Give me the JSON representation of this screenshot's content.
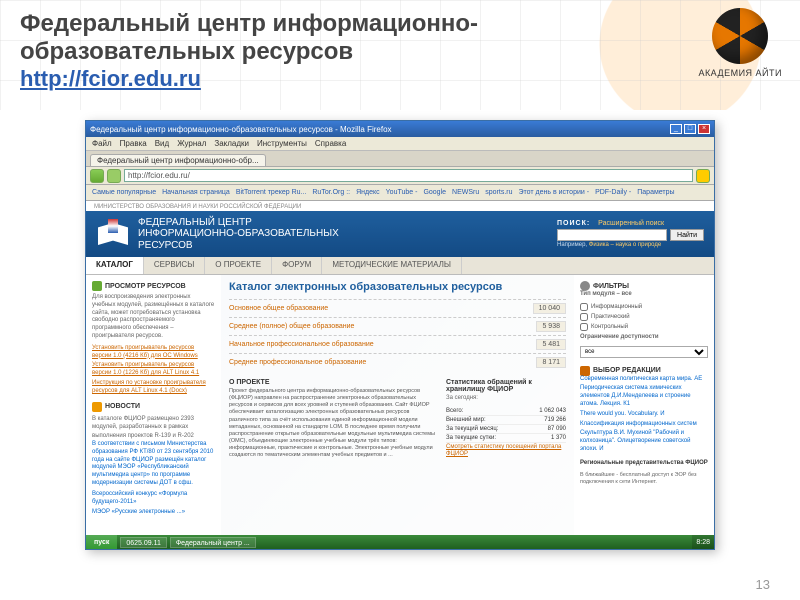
{
  "slide": {
    "title_l1": "Федеральный центр информационно-",
    "title_l2": "образовательных ресурсов",
    "url": "http://fcior.edu.ru",
    "logo_text": "АКАДЕМИЯ АЙТИ",
    "number": "13"
  },
  "browser": {
    "window_title": "Федеральный центр информационно-образовательных ресурсов - Mozilla Firefox",
    "menus": [
      "Файл",
      "Правка",
      "Вид",
      "Журнал",
      "Закладки",
      "Инструменты",
      "Справка"
    ],
    "tab": "Федеральный центр информационно-обр...",
    "address": "http://fcior.edu.ru/",
    "bookmarks": [
      "Самые популярные",
      "Начальная страница",
      "BitTorrent трекер Ru...",
      "RuTor.Org ::",
      "Яндекс",
      "YouTube -",
      "Google",
      "NEWSru",
      "sports.ru",
      "Этот день в истории -",
      "PDF-Daily -",
      "Параметры"
    ]
  },
  "site": {
    "ministry": "МИНИСТЕРСТВО ОБРАЗОВАНИЯ И НАУКИ РОССИЙСКОЙ ФЕДЕРАЦИИ",
    "name_l1": "ФЕДЕРАЛЬНЫЙ ЦЕНТР",
    "name_l2": "ИНФОРМАЦИОННО-ОБРАЗОВАТЕЛЬНЫХ",
    "name_l3": "РЕСУРСОВ",
    "search_label": "ПОИСК:",
    "search_adv": "Расширенный поиск",
    "search_btn": "Найти",
    "search_hint_pre": "Например, ",
    "search_hint_link": "Физика – наука о природе",
    "tabs": [
      "КАТАЛОГ",
      "СЕРВИСЫ",
      "О ПРОЕКТЕ",
      "ФОРУМ",
      "МЕТОДИЧЕСКИЕ МАТЕРИАЛЫ"
    ]
  },
  "left": {
    "view_hdr": "ПРОСМОТР РЕСУРСОВ",
    "view_txt": "Для воспроизведения электронных учебных модулей, размещённых в каталоге сайта, может потребоваться установка свободно распространяемого программного обеспечения – проигрывателя ресурсов.",
    "dl1": "Установить проигрыватель ресурсов версии 1.0 (4216 Кб) для ОС Windows",
    "dl2": "Установить проигрыватель ресурсов версии 1.0 (1226 Кб) для ALT Linux 4.1",
    "dl3": "Инструкция по установке проигрывателя ресурсов для ALT Linux 4.1 (Docx)",
    "news_hdr": "НОВОСТИ",
    "news1": "В каталоге ФЦИОР размещено 2393 модулей, разработанных в рамках выполнения проектов R-139 и R-202",
    "news2": "В соответствии с письмом Министерства образования РФ КТ/80 от 23 сентября 2010 года на сайте ФЦИОР размещён каталог модулей МЭОР «Республиканский мультимедиа центр» по программе модернизации системы ДОТ в сфш.",
    "news3": "Всероссийский конкурс «Формула будущего-2011»",
    "news4": "МЭОР «Русские электронные ...»"
  },
  "main": {
    "heading": "Каталог электронных образовательных ресурсов",
    "cats": [
      {
        "name": "Основное общее образование",
        "count": "10 040"
      },
      {
        "name": "Среднее (полное) общее образование",
        "count": "5 938"
      },
      {
        "name": "Начальное профессиональное образование",
        "count": "5 481"
      },
      {
        "name": "Среднее профессиональное образование",
        "count": "8 171"
      }
    ],
    "about_hdr": "О ПРОЕКТЕ",
    "about_txt": "Проект федерального центра информационно-образовательных ресурсов (ФЦИОР) направлен на распространение электронных образовательных ресурсов и сервисов для всех уровней и ступеней образования. Сайт ФЦИОР обеспечивает каталогизацию электронных образовательных ресурсов различного типа за счёт использования единой информационной модели метаданных, основанной на стандарте LOM. В последнее время получили распространение открытые образовательные модульные мультимедиа системы (ОМС), объединяющие электронные учебные модули трёх типов: информационные, практические и контрольные. Электронные учебные модули создаются по тематическим элементам учебных предметов и ...",
    "stats_hdr": "Статистика обращений к хранилищу ФЦИОР",
    "stats_period": "За сегодня:",
    "stats": [
      {
        "k": "Всего:",
        "v": "1 062 043"
      },
      {
        "k": "Внешний мир:",
        "v": "719 266"
      },
      {
        "k": "За текущий месяц:",
        "v": "87 090"
      },
      {
        "k": "За текущие сутки:",
        "v": "1 370"
      }
    ],
    "stats_link": "Смотреть статистику посещений портала ФЦИОР"
  },
  "right": {
    "filter_hdr": "ФИЛЬТРЫ",
    "typemod": "Тип модуля – все",
    "chk1": "Информационный",
    "chk2": "Практический",
    "chk3": "Контрольный",
    "limit_lbl": "Ограничение доступности",
    "limit_val": "все",
    "pick_hdr": "ВЫБОР РЕДАКЦИИ",
    "pick1": "Современная политическая карта мира. АЕ",
    "pick2": "Периодическая система химических элементов Д.И.Менделеева и строение атома. Лекция. К1",
    "pick3": "There would you. Vocabulary. И",
    "pick4": "Классификация информационных систем",
    "pick5": "Скульптура В.И. Мухиной \"Рабочий и колхозница\". Олицетворение советской эпохи. И",
    "reps_hdr": "Региональные представительства ФЦИОР",
    "reps_txt": "В ближайшее - бесплатный доступ к ЭОР без подключения к сети Интернет."
  },
  "taskbar": {
    "start": "пуск",
    "items": [
      "0625.09.11",
      "Федеральный центр ..."
    ],
    "time": "8:28"
  }
}
